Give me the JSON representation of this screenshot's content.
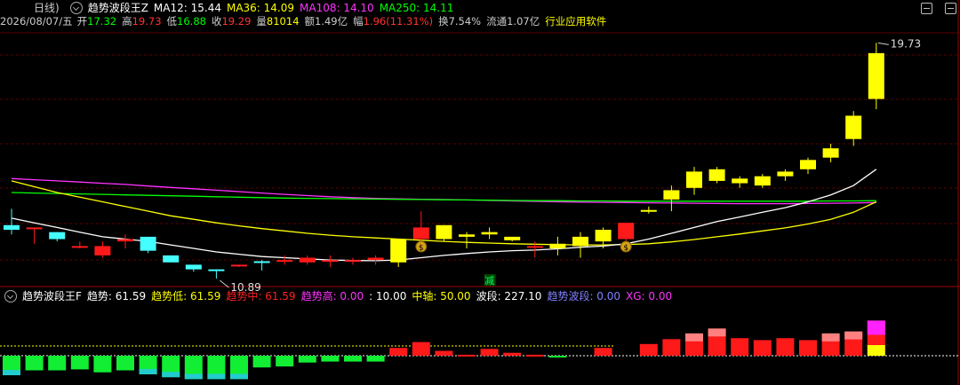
{
  "main": {
    "indicator_prefix": "日线)",
    "indicator_name": "趋势波段王Z",
    "ma": [
      {
        "label": "MA12:",
        "value": "15.44",
        "color": "#ffffff"
      },
      {
        "label": "MA36:",
        "value": "14.09",
        "color": "#ffff00"
      },
      {
        "label": "MA108:",
        "value": "14.10",
        "color": "#ff33ff"
      },
      {
        "label": "MA250:",
        "value": "14.11",
        "color": "#00ff00"
      }
    ],
    "quote": {
      "date": "2026/08/07/五",
      "open_label": "开",
      "open": "17.32",
      "high_label": "高",
      "high": "19.73",
      "low_label": "低",
      "low": "16.88",
      "close_label": "收",
      "close": "19.29",
      "vol_label": "量",
      "vol": "81014",
      "amt_label": "额",
      "amt": "1.49亿",
      "chg_label": "幅",
      "chg": "1.96(11.31%)",
      "turn_label": "换",
      "turn": "7.54%",
      "float_label": "流通",
      "float": "1.07亿",
      "industry": "行业应用软件"
    },
    "high_marker": "19.73",
    "low_marker": "10.89",
    "signal_label": "减",
    "money_icon_label": "$"
  },
  "sub": {
    "indicator_name": "趋势波段王F",
    "items": [
      {
        "label": "趋势:",
        "value": "61.59",
        "color": "#ffffff"
      },
      {
        "label": "趋势低:",
        "value": "61.59",
        "color": "#ffff00"
      },
      {
        "label": "趋势中:",
        "value": "61.59",
        "color": "#ff2020"
      },
      {
        "label": "趋势高:",
        "value": "0.00",
        "color": "#ff33ff"
      },
      {
        "label": ":",
        "value": "10.00",
        "color": "#ffffff"
      },
      {
        "label": "中轴:",
        "value": "50.00",
        "color": "#ffff00"
      },
      {
        "label": "波段:",
        "value": "227.10",
        "color": "#ffffff"
      },
      {
        "label": "趋势波段:",
        "value": "0.00",
        "color": "#8080ff"
      },
      {
        "label": "XG:",
        "value": "0.00",
        "color": "#ff33ff"
      }
    ]
  },
  "colors": {
    "up": "#ff1a1a",
    "down": "#44ffff",
    "yellow": "#ffff00",
    "grid": "#5a0000",
    "axis": "#a00000",
    "ma12": "#ffffff",
    "ma36": "#ffff00",
    "ma108": "#ff33ff",
    "ma250": "#00ff00"
  },
  "chart_data": {
    "type": "candlestick",
    "note_axis": "price",
    "candles": [
      {
        "o": 11.9,
        "h": 12.6,
        "l": 11.5,
        "c": 11.7,
        "style": "down"
      },
      {
        "o": 11.8,
        "h": 11.8,
        "l": 11.1,
        "c": 11.8,
        "style": "up"
      },
      {
        "o": 11.6,
        "h": 11.6,
        "l": 11.2,
        "c": 11.3,
        "style": "down"
      },
      {
        "o": 11.0,
        "h": 11.2,
        "l": 10.9,
        "c": 11.0,
        "style": "up"
      },
      {
        "o": 11.0,
        "h": 11.2,
        "l": 10.5,
        "c": 10.6,
        "style": "up"
      },
      {
        "o": 11.2,
        "h": 11.5,
        "l": 10.9,
        "c": 11.3,
        "style": "up"
      },
      {
        "o": 11.4,
        "h": 11.4,
        "l": 10.7,
        "c": 10.8,
        "style": "down"
      },
      {
        "o": 10.6,
        "h": 10.6,
        "l": 10.3,
        "c": 10.3,
        "style": "down"
      },
      {
        "o": 10.2,
        "h": 10.2,
        "l": 9.9,
        "c": 10.0,
        "style": "down"
      },
      {
        "o": 10.0,
        "h": 10.0,
        "l": 9.6,
        "c": 9.95,
        "style": "down"
      },
      {
        "o": 10.2,
        "h": 10.2,
        "l": 10.1,
        "c": 10.2,
        "style": "up"
      },
      {
        "o": 10.3,
        "h": 10.4,
        "l": 9.95,
        "c": 10.35,
        "style": "down"
      },
      {
        "o": 10.4,
        "h": 10.6,
        "l": 10.2,
        "c": 10.4,
        "style": "up"
      },
      {
        "o": 10.5,
        "h": 10.6,
        "l": 10.2,
        "c": 10.3,
        "style": "up"
      },
      {
        "o": 10.4,
        "h": 10.6,
        "l": 10.1,
        "c": 10.4,
        "style": "up"
      },
      {
        "o": 10.4,
        "h": 10.5,
        "l": 10.2,
        "c": 10.35,
        "style": "up"
      },
      {
        "o": 10.4,
        "h": 10.6,
        "l": 10.2,
        "c": 10.5,
        "style": "up"
      },
      {
        "o": 10.3,
        "h": 11.2,
        "l": 10.1,
        "c": 11.3,
        "style": "yellow"
      },
      {
        "o": 11.3,
        "h": 12.5,
        "l": 10.8,
        "c": 11.8,
        "style": "up"
      },
      {
        "o": 11.9,
        "h": 11.9,
        "l": 11.2,
        "c": 11.3,
        "style": "yellow"
      },
      {
        "o": 11.5,
        "h": 11.6,
        "l": 10.9,
        "c": 11.4,
        "style": "yellow"
      },
      {
        "o": 11.5,
        "h": 11.8,
        "l": 11.3,
        "c": 11.6,
        "style": "yellow"
      },
      {
        "o": 11.4,
        "h": 11.4,
        "l": 11.2,
        "c": 11.25,
        "style": "yellow"
      },
      {
        "o": 11.0,
        "h": 11.2,
        "l": 10.5,
        "c": 11.0,
        "style": "up"
      },
      {
        "o": 10.9,
        "h": 11.4,
        "l": 10.6,
        "c": 11.1,
        "style": "yellow"
      },
      {
        "o": 11.0,
        "h": 11.6,
        "l": 10.5,
        "c": 11.4,
        "style": "yellow"
      },
      {
        "o": 11.2,
        "h": 11.8,
        "l": 10.9,
        "c": 11.7,
        "style": "yellow"
      },
      {
        "o": 11.3,
        "h": 12.0,
        "l": 11.1,
        "c": 12.0,
        "style": "up"
      },
      {
        "o": 12.5,
        "h": 12.7,
        "l": 12.4,
        "c": 12.55,
        "style": "yellow"
      },
      {
        "o": 13.0,
        "h": 13.6,
        "l": 12.5,
        "c": 13.4,
        "style": "yellow"
      },
      {
        "o": 13.5,
        "h": 14.4,
        "l": 13.2,
        "c": 14.2,
        "style": "yellow"
      },
      {
        "o": 13.8,
        "h": 14.4,
        "l": 13.7,
        "c": 14.3,
        "style": "yellow"
      },
      {
        "o": 13.7,
        "h": 14.0,
        "l": 13.5,
        "c": 13.9,
        "style": "yellow"
      },
      {
        "o": 13.6,
        "h": 14.1,
        "l": 13.5,
        "c": 14.0,
        "style": "yellow"
      },
      {
        "o": 14.0,
        "h": 14.3,
        "l": 13.8,
        "c": 14.2,
        "style": "yellow"
      },
      {
        "o": 14.3,
        "h": 14.8,
        "l": 14.1,
        "c": 14.7,
        "style": "yellow"
      },
      {
        "o": 14.8,
        "h": 15.4,
        "l": 14.6,
        "c": 15.2,
        "style": "yellow"
      },
      {
        "o": 15.6,
        "h": 16.8,
        "l": 15.3,
        "c": 16.6,
        "style": "yellow"
      },
      {
        "o": 17.32,
        "h": 19.73,
        "l": 16.88,
        "c": 19.29,
        "style": "yellow"
      }
    ],
    "ma12": [
      12.2,
      12.0,
      11.8,
      11.6,
      11.4,
      11.3,
      11.2,
      11.05,
      10.9,
      10.75,
      10.65,
      10.55,
      10.5,
      10.45,
      10.4,
      10.38,
      10.37,
      10.4,
      10.5,
      10.6,
      10.68,
      10.75,
      10.8,
      10.83,
      10.88,
      10.95,
      11.0,
      11.1,
      11.3,
      11.55,
      11.8,
      12.05,
      12.25,
      12.45,
      12.65,
      12.9,
      13.2,
      13.6,
      14.3
    ],
    "ma36": [
      13.8,
      13.55,
      13.3,
      13.1,
      12.9,
      12.7,
      12.5,
      12.3,
      12.15,
      12.0,
      11.87,
      11.75,
      11.65,
      11.55,
      11.47,
      11.4,
      11.35,
      11.3,
      11.25,
      11.2,
      11.16,
      11.13,
      11.1,
      11.08,
      11.06,
      11.05,
      11.05,
      11.07,
      11.1,
      11.18,
      11.28,
      11.4,
      11.52,
      11.65,
      11.78,
      11.95,
      12.15,
      12.45,
      12.9
    ],
    "ma108": [
      13.9,
      13.85,
      13.8,
      13.75,
      13.7,
      13.65,
      13.58,
      13.52,
      13.46,
      13.4,
      13.34,
      13.28,
      13.22,
      13.17,
      13.12,
      13.08,
      13.05,
      13.03,
      13.01,
      13.0,
      12.98,
      12.96,
      12.94,
      12.92,
      12.9,
      12.89,
      12.88,
      12.87,
      12.86,
      12.85,
      12.84,
      12.83,
      12.82,
      12.82,
      12.82,
      12.83,
      12.84,
      12.85,
      12.87
    ],
    "ma250": [
      13.3,
      13.28,
      13.26,
      13.24,
      13.22,
      13.2,
      13.18,
      13.16,
      13.14,
      13.12,
      13.1,
      13.08,
      13.06,
      13.05,
      13.04,
      13.03,
      13.02,
      13.01,
      13.0,
      12.99,
      12.98,
      12.97,
      12.96,
      12.95,
      12.95,
      12.94,
      12.94,
      12.93,
      12.93,
      12.93,
      12.93,
      12.93,
      12.93,
      12.93,
      12.93,
      12.93,
      12.94,
      12.94,
      12.95
    ],
    "sub_bars": [
      {
        "v": -1.0,
        "color": "green",
        "stack": "cyan"
      },
      {
        "v": -0.75,
        "color": "green"
      },
      {
        "v": -0.75,
        "color": "green"
      },
      {
        "v": -0.7,
        "color": "green"
      },
      {
        "v": -0.85,
        "color": "green"
      },
      {
        "v": -0.75,
        "color": "green"
      },
      {
        "v": -0.95,
        "color": "green",
        "stack": "cyan"
      },
      {
        "v": -1.1,
        "color": "green",
        "stack": "cyan"
      },
      {
        "v": -1.2,
        "color": "green",
        "stack": "cyan"
      },
      {
        "v": -1.2,
        "color": "green",
        "stack": "cyan"
      },
      {
        "v": -1.2,
        "color": "green",
        "stack": "cyan"
      },
      {
        "v": -0.6,
        "color": "green"
      },
      {
        "v": -0.55,
        "color": "green"
      },
      {
        "v": -0.35,
        "color": "green"
      },
      {
        "v": -0.3,
        "color": "green"
      },
      {
        "v": -0.3,
        "color": "green"
      },
      {
        "v": -0.3,
        "color": "green"
      },
      {
        "v": 0.4,
        "color": "red"
      },
      {
        "v": 0.7,
        "color": "red"
      },
      {
        "v": 0.25,
        "color": "red"
      },
      {
        "v": 0.05,
        "color": "red"
      },
      {
        "v": 0.35,
        "color": "red"
      },
      {
        "v": 0.15,
        "color": "red"
      },
      {
        "v": 0.05,
        "color": "red"
      },
      {
        "v": -0.07,
        "color": "green"
      },
      {
        "v": 0.0,
        "color": "none"
      },
      {
        "v": 0.4,
        "color": "red"
      },
      {
        "v": 0.0,
        "color": "none"
      },
      {
        "v": 0.6,
        "color": "red"
      },
      {
        "v": 0.85,
        "color": "red"
      },
      {
        "v": 1.1,
        "color": "red",
        "stack": "pink"
      },
      {
        "v": 1.35,
        "color": "red",
        "stack": "pink"
      },
      {
        "v": 0.9,
        "color": "red"
      },
      {
        "v": 0.8,
        "color": "red"
      },
      {
        "v": 0.9,
        "color": "red"
      },
      {
        "v": 0.8,
        "color": "red"
      },
      {
        "v": 1.1,
        "color": "red",
        "stack": "pink"
      },
      {
        "v": 1.2,
        "color": "red",
        "stack": "pink"
      },
      {
        "v": 1.8,
        "color": "red",
        "stack": "magenta"
      }
    ]
  }
}
